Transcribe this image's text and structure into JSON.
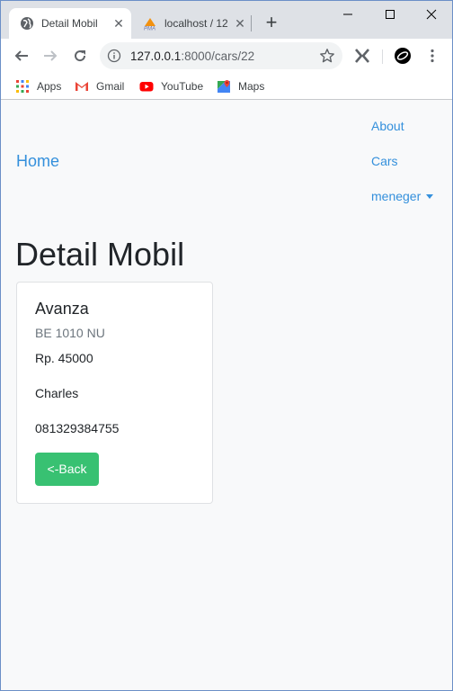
{
  "browser": {
    "tabs": [
      {
        "title": "Detail Mobil",
        "active": true
      },
      {
        "title": "localhost / 12",
        "active": false
      }
    ],
    "address": {
      "host": "127.0.0.1",
      "path": ":8000/cars/22"
    },
    "bookmarks": [
      {
        "label": "Apps",
        "icon": "apps-grid-icon"
      },
      {
        "label": "Gmail",
        "icon": "gmail-icon"
      },
      {
        "label": "YouTube",
        "icon": "youtube-icon"
      },
      {
        "label": "Maps",
        "icon": "maps-icon"
      }
    ]
  },
  "nav": {
    "home": "Home",
    "links": [
      "About",
      "Cars",
      "meneger"
    ]
  },
  "page": {
    "title": "Detail Mobil",
    "card": {
      "name": "Avanza",
      "plate": "BE 1010 NU",
      "price": "Rp. 45000",
      "owner": "Charles",
      "phone": "081329384755",
      "back_label": "<-Back"
    }
  },
  "colors": {
    "link": "#3490dc",
    "success": "#38c172",
    "page_bg": "#f8f9fa"
  }
}
